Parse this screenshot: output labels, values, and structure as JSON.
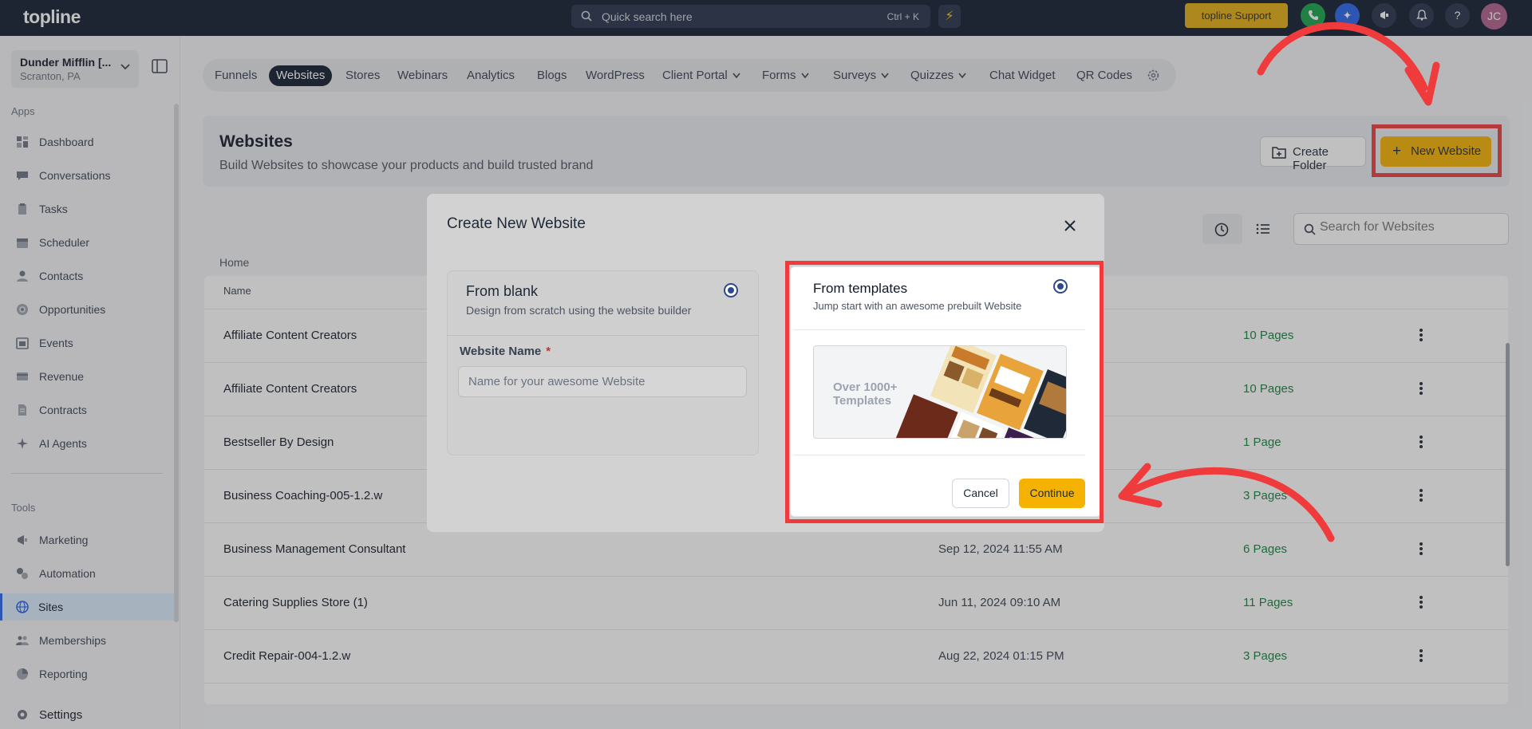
{
  "topbar": {
    "logo": "topline",
    "search_placeholder": "Quick search here",
    "search_shortcut": "Ctrl + K",
    "support_label": "topline Support",
    "avatar_initials": "JC"
  },
  "sidebar": {
    "account_name": "Dunder Mifflin [...",
    "account_location": "Scranton, PA",
    "apps_label": "Apps",
    "apps": [
      {
        "label": "Dashboard",
        "icon": "dashboard-icon"
      },
      {
        "label": "Conversations",
        "icon": "chat-icon"
      },
      {
        "label": "Tasks",
        "icon": "clipboard-icon"
      },
      {
        "label": "Scheduler",
        "icon": "calendar-icon"
      },
      {
        "label": "Contacts",
        "icon": "user-icon"
      },
      {
        "label": "Opportunities",
        "icon": "target-icon"
      },
      {
        "label": "Events",
        "icon": "events-icon"
      },
      {
        "label": "Revenue",
        "icon": "card-icon"
      },
      {
        "label": "Contracts",
        "icon": "document-icon"
      },
      {
        "label": "AI Agents",
        "icon": "sparkle-icon"
      }
    ],
    "tools_label": "Tools",
    "tools": [
      {
        "label": "Marketing",
        "icon": "megaphone-icon"
      },
      {
        "label": "Automation",
        "icon": "gears-icon"
      },
      {
        "label": "Sites",
        "icon": "globe-icon",
        "active": true
      },
      {
        "label": "Memberships",
        "icon": "members-icon"
      },
      {
        "label": "Reporting",
        "icon": "pie-icon"
      }
    ],
    "settings_label": "Settings"
  },
  "tabs": [
    "Funnels",
    "Websites",
    "Stores",
    "Webinars",
    "Analytics",
    "Blogs",
    "WordPress",
    "Client Portal",
    "Forms",
    "Surveys",
    "Quizzes",
    "Chat Widget",
    "QR Codes"
  ],
  "active_tab": "Websites",
  "header": {
    "title": "Websites",
    "subtitle": "Build Websites to showcase your products and build trusted brand",
    "create_folder": "Create Folder",
    "new_website": "New Website"
  },
  "search_websites_placeholder": "Search for Websites",
  "breadcrumb": "Home",
  "table": {
    "column_name": "Name",
    "rows": [
      {
        "name": "Affiliate Content Creators",
        "date": "",
        "pages": "10 Pages"
      },
      {
        "name": "Affiliate Content Creators",
        "date": "",
        "pages": "10 Pages"
      },
      {
        "name": "Bestseller By Design",
        "date": "",
        "pages": "1 Page"
      },
      {
        "name": "Business Coaching-005-1.2.w",
        "date": "",
        "pages": "3 Pages"
      },
      {
        "name": "Business Management Consultant",
        "date": "Sep 12, 2024 11:55 AM",
        "pages": "6 Pages"
      },
      {
        "name": "Catering Supplies Store (1)",
        "date": "Jun 11, 2024 09:10 AM",
        "pages": "11 Pages"
      },
      {
        "name": "Credit Repair-004-1.2.w",
        "date": "Aug 22, 2024 01:15 PM",
        "pages": "3 Pages"
      }
    ]
  },
  "modal": {
    "title": "Create New Website",
    "blank_title": "From blank",
    "blank_desc": "Design from scratch using the website builder",
    "website_name_label": "Website Name",
    "required_mark": "*",
    "website_name_placeholder": "Name for your awesome Website",
    "templates_title": "From templates",
    "templates_desc": "Jump start with an awesome prebuilt Website",
    "preview_text": "Over 1000+ Templates",
    "cancel": "Cancel",
    "continue": "Continue"
  },
  "colors": {
    "topbar": "#0f1a2e",
    "accent": "#f5b200",
    "highlight": "#ef3b3b",
    "pages_green": "#15803d"
  }
}
